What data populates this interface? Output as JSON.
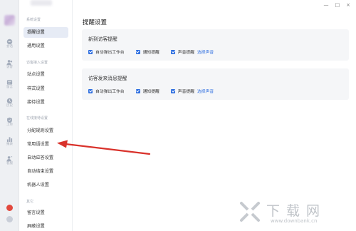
{
  "rail": {
    "items": [
      {
        "icon": "chat-icon",
        "label": "会话"
      },
      {
        "icon": "visitor-icon",
        "label": "访客"
      },
      {
        "icon": "message-icon",
        "label": "留言"
      },
      {
        "icon": "history-icon",
        "label": "历史"
      },
      {
        "icon": "ticket-icon",
        "label": "工单"
      },
      {
        "icon": "report-icon",
        "label": "报表"
      },
      {
        "icon": "team-icon",
        "label": "客服"
      }
    ]
  },
  "nav": {
    "groups": [
      {
        "label": "系统设置",
        "items": [
          "提醒设置",
          "通用设置"
        ]
      },
      {
        "label": "访客接入设置",
        "items": [
          "站点设置",
          "样式设置",
          "接待设置"
        ]
      },
      {
        "label": "在线接待设置",
        "items": [
          "分配规则设置",
          "常用语设置",
          "自动应答设置",
          "自动结束设置",
          "机器人设置"
        ]
      },
      {
        "label": "其它",
        "items": [
          "留言设置",
          "屏蔽设置"
        ]
      }
    ],
    "active": "提醒设置"
  },
  "main": {
    "title": "提醒设置",
    "cards": [
      {
        "title": "新到访客提醒",
        "options": [
          "自动弹出工作台",
          "通知提醒",
          "声音提醒"
        ],
        "link": "选择声音"
      },
      {
        "title": "访客发来消息提醒",
        "options": [
          "自动弹出工作台",
          "通知提醒",
          "声音提醒"
        ],
        "link": "选择声音"
      }
    ]
  },
  "window": {
    "minimize": "—",
    "maximize": "□",
    "close": "×"
  },
  "watermark": {
    "text": "下载网",
    "url": "www.downbank.cn"
  },
  "colors": {
    "accent": "#2f6fe0",
    "arrow": "#d9322b",
    "active_bg": "#e6ebf5",
    "card_bg": "#f5f6f8"
  }
}
